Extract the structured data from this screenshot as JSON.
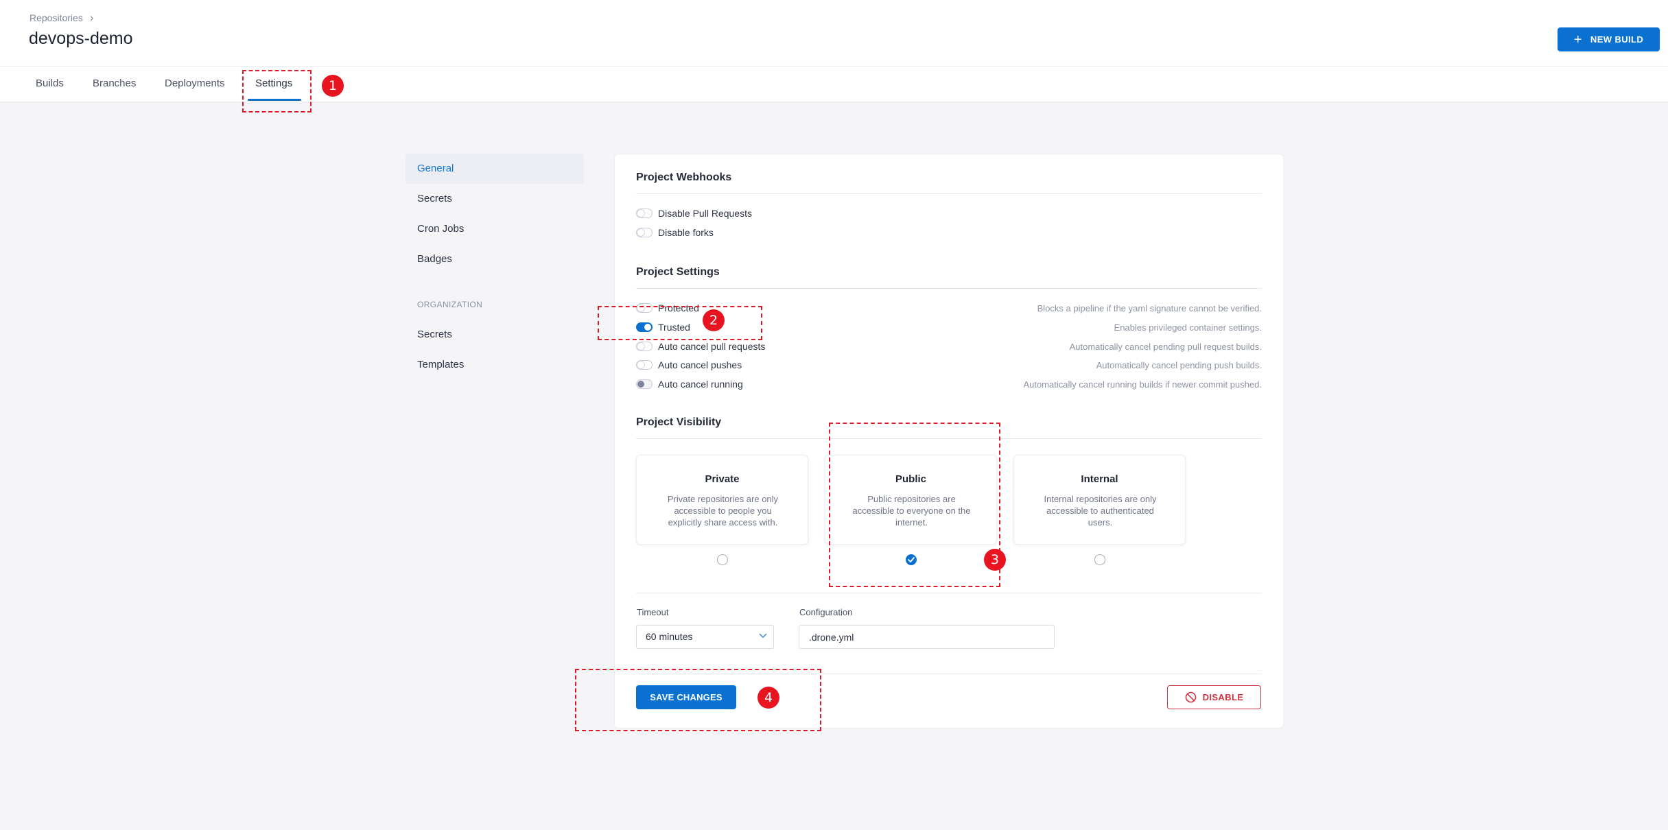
{
  "header": {
    "breadcrumb": "Repositories",
    "title": "devops-demo",
    "new_build_label": "NEW BUILD"
  },
  "tabs": [
    {
      "label": "Builds"
    },
    {
      "label": "Branches"
    },
    {
      "label": "Deployments"
    },
    {
      "label": "Settings",
      "active": true
    }
  ],
  "sidebar": {
    "items": [
      {
        "label": "General",
        "active": true
      },
      {
        "label": "Secrets"
      },
      {
        "label": "Cron Jobs"
      },
      {
        "label": "Badges"
      }
    ],
    "org_heading": "ORGANIZATION",
    "org_items": [
      {
        "label": "Secrets"
      },
      {
        "label": "Templates"
      }
    ]
  },
  "webhooks": {
    "title": "Project Webhooks",
    "options": [
      {
        "label": "Disable Pull Requests",
        "enabled": false
      },
      {
        "label": "Disable forks",
        "enabled": false
      }
    ]
  },
  "settings": {
    "title": "Project Settings",
    "options": [
      {
        "label": "Protected",
        "description": "Blocks a pipeline if the yaml signature cannot be verified.",
        "enabled": false
      },
      {
        "label": "Trusted",
        "description": "Enables privileged container settings.",
        "enabled": true
      },
      {
        "label": "Auto cancel pull requests",
        "description": "Automatically cancel pending pull request builds.",
        "enabled": false
      },
      {
        "label": "Auto cancel pushes",
        "description": "Automatically cancel pending push builds.",
        "enabled": false
      },
      {
        "label": "Auto cancel running",
        "description": "Automatically cancel running builds if newer commit pushed.",
        "enabled": false
      }
    ]
  },
  "visibility": {
    "title": "Project Visibility",
    "options": [
      {
        "title": "Private",
        "description": "Private repositories are only accessible to people you explicitly share access with.",
        "selected": false
      },
      {
        "title": "Public",
        "description": "Public repositories are accessible to everyone on the internet.",
        "selected": true
      },
      {
        "title": "Internal",
        "description": "Internal repositories are only accessible to authenticated users.",
        "selected": false
      }
    ]
  },
  "form": {
    "timeout_label": "Timeout",
    "timeout_value": "60 minutes",
    "config_label": "Configuration",
    "config_value": ".drone.yml"
  },
  "actions": {
    "save_label": "SAVE CHANGES",
    "disable_label": "DISABLE"
  },
  "annotations": [
    "1",
    "2",
    "3",
    "4"
  ],
  "colors": {
    "accent": "#0a71d1",
    "danger": "#d1323f",
    "annotation": "#e8141f",
    "background": "#f5f5f8"
  }
}
